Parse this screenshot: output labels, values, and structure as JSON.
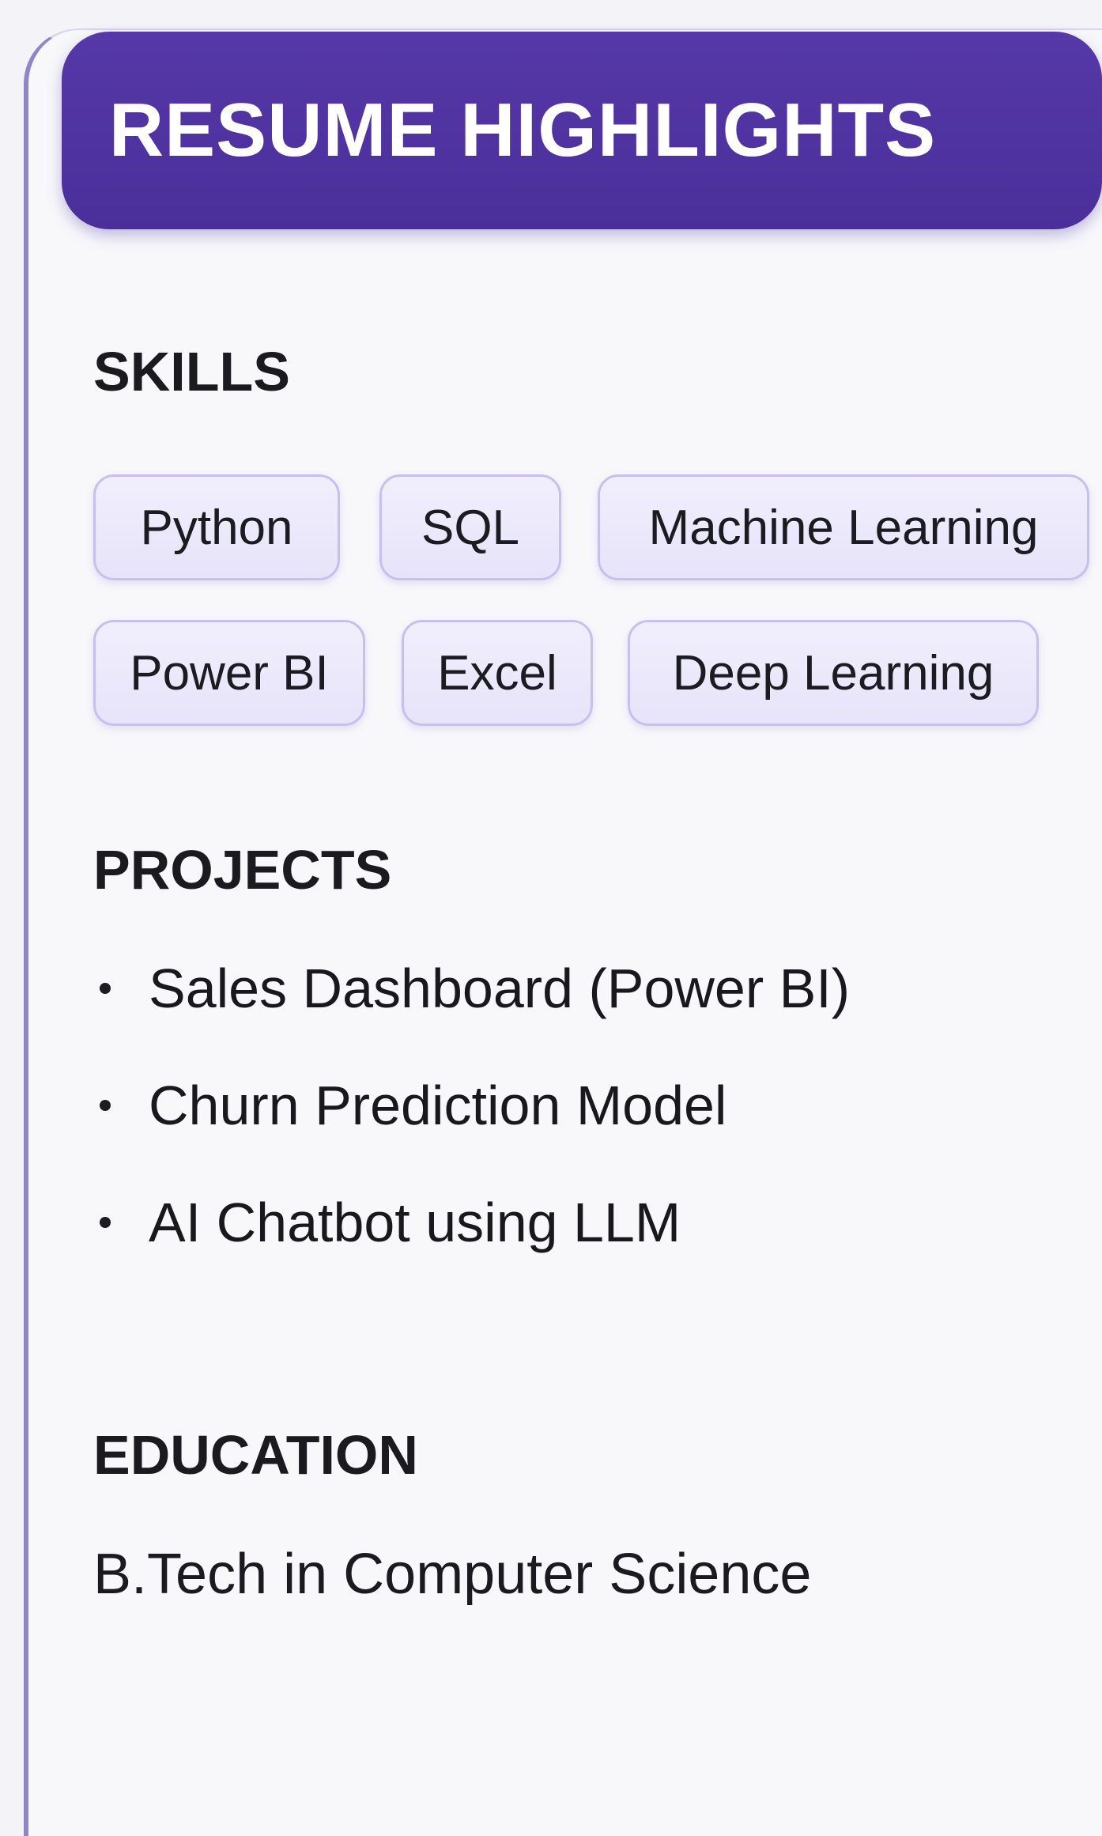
{
  "header": {
    "title": "RESUME HIGHLIGHTS"
  },
  "skills": {
    "title": "SKILLS",
    "items": [
      "Python",
      "SQL",
      "Machine Learning",
      "Power BI",
      "Excel",
      "Deep Learning"
    ]
  },
  "projects": {
    "title": "PROJECTS",
    "items": [
      "Sales Dashboard (Power BI)",
      "Churn Prediction Model",
      "AI Chatbot using LLM"
    ]
  },
  "education": {
    "title": "EDUCATION",
    "text": "B.Tech in Computer Science"
  },
  "colors": {
    "header_bg": "#4a2f9a",
    "chip_border": "#c6bff0",
    "chip_bg": "#ece9fb",
    "accent_border": "#8f86c9"
  }
}
